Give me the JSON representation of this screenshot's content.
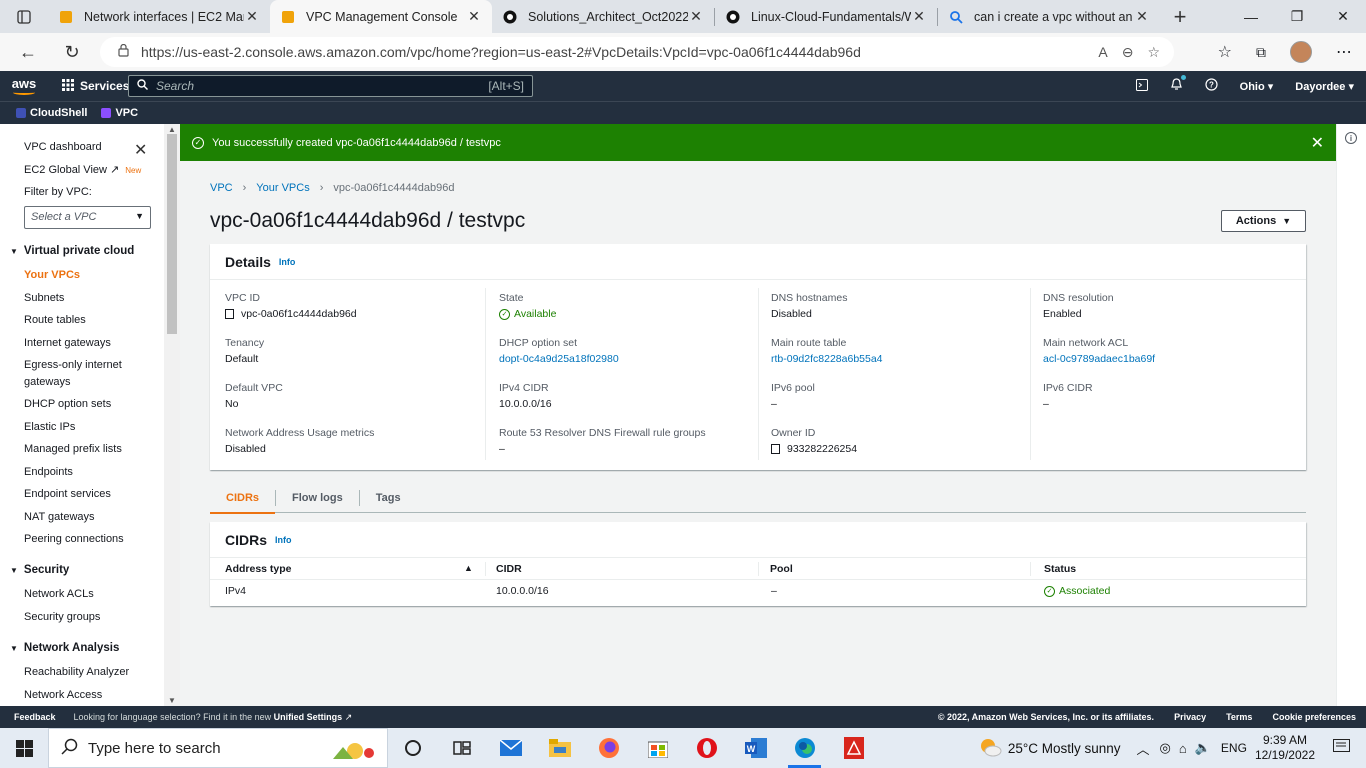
{
  "browser": {
    "tabs": [
      {
        "title": "Network interfaces | EC2 Man",
        "icon": "aws-box-icon",
        "active": false
      },
      {
        "title": "VPC Management Console",
        "icon": "aws-box-icon",
        "active": true
      },
      {
        "title": "Solutions_Architect_Oct2022/",
        "icon": "github-icon",
        "active": false
      },
      {
        "title": "Linux-Cloud-Fundamentals/W",
        "icon": "github-icon",
        "active": false
      },
      {
        "title": "can i create a vpc without an",
        "icon": "bing-search-icon",
        "active": false
      }
    ],
    "url": "https://us-east-2.console.aws.amazon.com/vpc/home?region=us-east-2#VpcDetails:VpcId=vpc-0a06f1c4444dab96d"
  },
  "aws_nav": {
    "logo": "aws",
    "services_label": "Services",
    "search_placeholder": "Search",
    "search_shortcut": "[Alt+S]",
    "region": "Ohio",
    "account": "Dayordee"
  },
  "favorites": [
    {
      "label": "CloudShell",
      "color": "#3f51b5"
    },
    {
      "label": "VPC",
      "color": "#8c4fff"
    }
  ],
  "sidebar": {
    "dashboard": "VPC dashboard",
    "ec2_global_view": "EC2 Global View",
    "new_badge": "New",
    "filter_label": "Filter by VPC:",
    "filter_placeholder": "Select a VPC",
    "sections": [
      {
        "title": "Virtual private cloud",
        "items": [
          "Your VPCs",
          "Subnets",
          "Route tables",
          "Internet gateways",
          "Egress-only internet gateways",
          "DHCP option sets",
          "Elastic IPs",
          "Managed prefix lists",
          "Endpoints",
          "Endpoint services",
          "NAT gateways",
          "Peering connections"
        ]
      },
      {
        "title": "Security",
        "items": [
          "Network ACLs",
          "Security groups"
        ]
      },
      {
        "title": "Network Analysis",
        "items": [
          "Reachability Analyzer",
          "Network Access"
        ]
      }
    ]
  },
  "flash": {
    "message": "You successfully created vpc-0a06f1c4444dab96d / testvpc",
    "color": "#1d8102"
  },
  "breadcrumb": [
    "VPC",
    "Your VPCs",
    "vpc-0a06f1c4444dab96d"
  ],
  "page_title": "vpc-0a06f1c4444dab96d / testvpc",
  "actions_label": "Actions",
  "details": {
    "title": "Details",
    "info": "Info",
    "columns": [
      [
        {
          "label": "VPC ID",
          "value": "vpc-0a06f1c4444dab96d",
          "kind": "copy"
        },
        {
          "label": "Tenancy",
          "value": "Default",
          "kind": "text"
        },
        {
          "label": "Default VPC",
          "value": "No",
          "kind": "text"
        },
        {
          "label": "Network Address Usage metrics",
          "value": "Disabled",
          "kind": "text"
        }
      ],
      [
        {
          "label": "State",
          "value": "Available",
          "kind": "status"
        },
        {
          "label": "DHCP option set",
          "value": "dopt-0c4a9d25a18f02980",
          "kind": "link"
        },
        {
          "label": "IPv4 CIDR",
          "value": "10.0.0.0/16",
          "kind": "text"
        },
        {
          "label": "Route 53 Resolver DNS Firewall rule groups",
          "value": "–",
          "kind": "text"
        }
      ],
      [
        {
          "label": "DNS hostnames",
          "value": "Disabled",
          "kind": "text"
        },
        {
          "label": "Main route table",
          "value": "rtb-09d2fc8228a6b55a4",
          "kind": "link"
        },
        {
          "label": "IPv6 pool",
          "value": "–",
          "kind": "text"
        },
        {
          "label": "Owner ID",
          "value": "933282226254",
          "kind": "copy"
        }
      ],
      [
        {
          "label": "DNS resolution",
          "value": "Enabled",
          "kind": "text"
        },
        {
          "label": "Main network ACL",
          "value": "acl-0c9789adaec1ba69f",
          "kind": "link"
        },
        {
          "label": "IPv6 CIDR",
          "value": "–",
          "kind": "text"
        }
      ]
    ]
  },
  "content_tabs": [
    "CIDRs",
    "Flow logs",
    "Tags"
  ],
  "cidrs": {
    "title": "CIDRs",
    "info": "Info",
    "headers": [
      "Address type",
      "CIDR",
      "Pool",
      "Status"
    ],
    "rows": [
      {
        "address_type": "IPv4",
        "cidr": "10.0.0.0/16",
        "pool": "–",
        "status": "Associated"
      }
    ]
  },
  "footer": {
    "feedback": "Feedback",
    "message": "Looking for language selection? Find it in the new ",
    "unified": "Unified Settings",
    "copyright": "© 2022, Amazon Web Services, Inc. or its affiliates.",
    "links": [
      "Privacy",
      "Terms",
      "Cookie preferences"
    ]
  },
  "taskbar": {
    "search_placeholder": "Type here to search",
    "weather": "25°C  Mostly sunny",
    "language": "ENG",
    "time": "9:39 AM",
    "date": "12/19/2022"
  }
}
